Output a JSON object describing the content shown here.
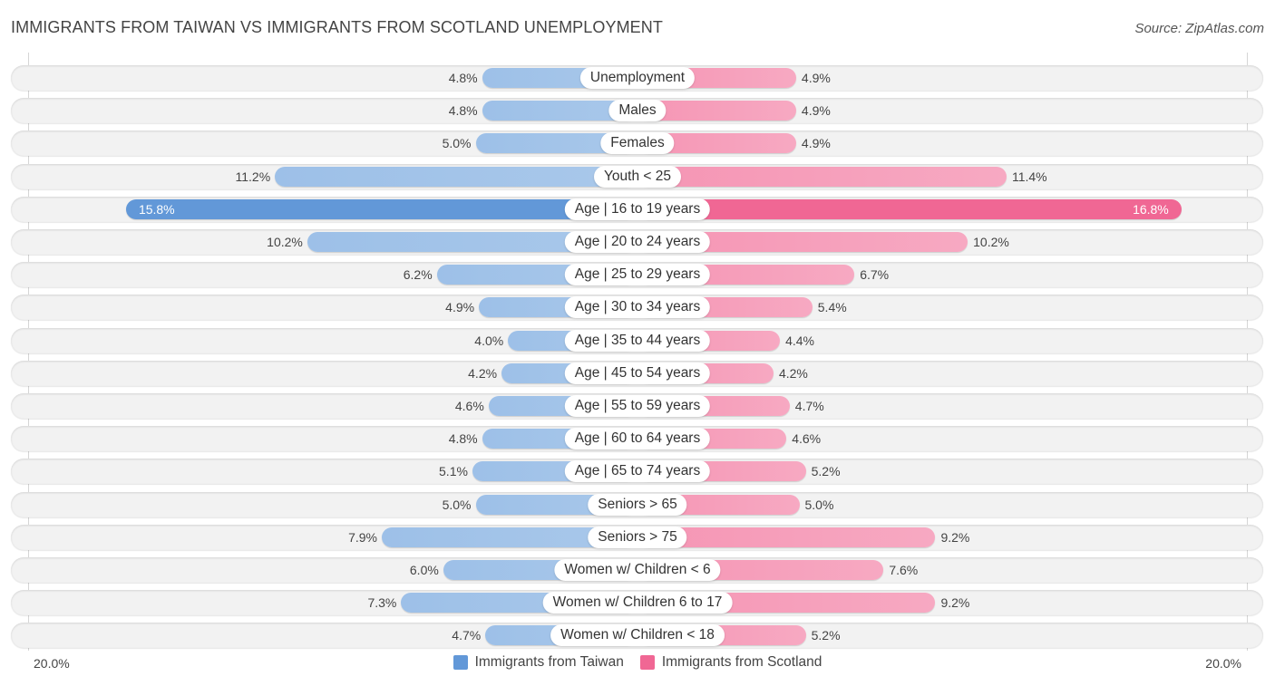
{
  "header": {
    "title": "IMMIGRANTS FROM TAIWAN VS IMMIGRANTS FROM SCOTLAND UNEMPLOYMENT",
    "source": "Source: ZipAtlas.com"
  },
  "colors": {
    "taiwan": "#6298d8",
    "scotland": "#f06794"
  },
  "chart_data": {
    "type": "bar",
    "orientation": "horizontal-diverging",
    "title": "IMMIGRANTS FROM TAIWAN VS IMMIGRANTS FROM SCOTLAND UNEMPLOYMENT",
    "xlabel": "",
    "ylabel": "",
    "xlim": [
      -20,
      20
    ],
    "axis_labels": {
      "left": "20.0%",
      "right": "20.0%"
    },
    "unit": "%",
    "legend_position": "bottom-center",
    "categories": [
      "Unemployment",
      "Males",
      "Females",
      "Youth < 25",
      "Age | 16 to 19 years",
      "Age | 20 to 24 years",
      "Age | 25 to 29 years",
      "Age | 30 to 34 years",
      "Age | 35 to 44 years",
      "Age | 45 to 54 years",
      "Age | 55 to 59 years",
      "Age | 60 to 64 years",
      "Age | 65 to 74 years",
      "Seniors > 65",
      "Seniors > 75",
      "Women w/ Children < 6",
      "Women w/ Children 6 to 17",
      "Women w/ Children < 18"
    ],
    "series": [
      {
        "name": "Immigrants from Taiwan",
        "side": "left",
        "values": [
          4.8,
          4.8,
          5.0,
          11.2,
          15.8,
          10.2,
          6.2,
          4.9,
          4.0,
          4.2,
          4.6,
          4.8,
          5.1,
          5.0,
          7.9,
          6.0,
          7.3,
          4.7
        ],
        "labels": [
          "4.8%",
          "4.8%",
          "5.0%",
          "11.2%",
          "15.8%",
          "10.2%",
          "6.2%",
          "4.9%",
          "4.0%",
          "4.2%",
          "4.6%",
          "4.8%",
          "5.1%",
          "5.0%",
          "7.9%",
          "6.0%",
          "7.3%",
          "4.7%"
        ]
      },
      {
        "name": "Immigrants from Scotland",
        "side": "right",
        "values": [
          4.9,
          4.9,
          4.9,
          11.4,
          16.8,
          10.2,
          6.7,
          5.4,
          4.4,
          4.2,
          4.7,
          4.6,
          5.2,
          5.0,
          9.2,
          7.6,
          9.2,
          5.2
        ],
        "labels": [
          "4.9%",
          "4.9%",
          "4.9%",
          "11.4%",
          "16.8%",
          "10.2%",
          "6.7%",
          "5.4%",
          "4.4%",
          "4.2%",
          "4.7%",
          "4.6%",
          "5.2%",
          "5.0%",
          "9.2%",
          "7.6%",
          "9.2%",
          "5.2%"
        ]
      }
    ],
    "highlighted_category": "Age | 16 to 19 years"
  },
  "legend": {
    "items": [
      {
        "label": "Immigrants from Taiwan"
      },
      {
        "label": "Immigrants from Scotland"
      }
    ]
  }
}
